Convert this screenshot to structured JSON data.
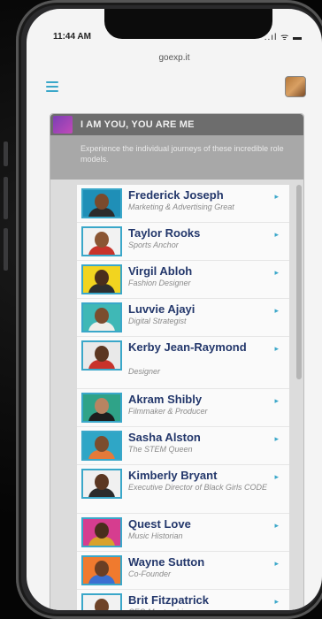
{
  "status": {
    "time": "11:44 AM",
    "icons": "..ıl ᯤ ▬"
  },
  "browser": {
    "url": "goexp.it"
  },
  "header": {
    "menu_icon": "hamburger-icon",
    "avatar": "user-avatar"
  },
  "card": {
    "title": "I AM YOU, YOU ARE ME",
    "description": "Experience the individual journeys of these incredible role models."
  },
  "people": [
    {
      "name": "Frederick Joseph",
      "role": "Marketing & Advertising Great",
      "bg": "#1f8fb7",
      "face": "#7a4a2c",
      "shirt": "#2b2b2b"
    },
    {
      "name": "Taylor Rooks",
      "role": "Sports Anchor",
      "bg": "#f2f2f2",
      "face": "#8a5634",
      "shirt": "#c8332b"
    },
    {
      "name": "Virgil Abloh",
      "role": "Fashion Designer",
      "bg": "#f2d41f",
      "face": "#4a2e1c",
      "shirt": "#2e2e2e"
    },
    {
      "name": "Luvvie Ajayi",
      "role": "Digital Strategist",
      "bg": "#3fb8b6",
      "face": "#7b4d2e",
      "shirt": "#f0efe9"
    },
    {
      "name": "Kerby Jean-Raymond",
      "role": "Designer",
      "bg": "#e9e9e9",
      "face": "#5b3722",
      "shirt": "#c8332b"
    },
    {
      "name": "Akram Shibly",
      "role": "Filmmaker & Producer",
      "bg": "#2fa388",
      "face": "#b88462",
      "shirt": "#1d1d1d"
    },
    {
      "name": "Sasha Alston",
      "role": "The STEM Queen",
      "bg": "#2fa6c6",
      "face": "#7b4d2e",
      "shirt": "#e47a3a"
    },
    {
      "name": "Kimberly Bryant",
      "role": "Executive Director of Black Girls CODE",
      "bg": "#f0f0f0",
      "face": "#5b3722",
      "shirt": "#2b2b2b"
    },
    {
      "name": "Quest Love",
      "role": "Music Historian",
      "bg": "#d63d8f",
      "face": "#4a2e1c",
      "shirt": "#d8a22b"
    },
    {
      "name": "Wayne Sutton",
      "role": "Co-Founder",
      "bg": "#f07a2e",
      "face": "#6b3f24",
      "shirt": "#3b6fd1"
    },
    {
      "name": "Brit Fitzpatrick",
      "role": "CEO Mentorship",
      "bg": "#f2f2f2",
      "face": "#6e4328",
      "shirt": "#2b2b2b"
    }
  ],
  "colors": {
    "accent": "#3aa7c9",
    "name": "#23376b",
    "card_header": "#6d6d6d"
  }
}
